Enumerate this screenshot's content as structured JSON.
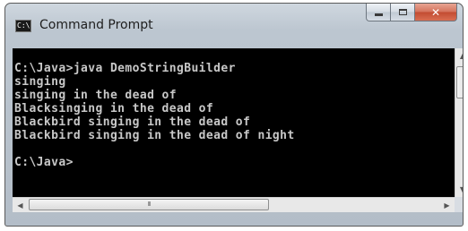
{
  "window": {
    "title": "Command Prompt",
    "icon": "cmd-icon",
    "icon_label": "C:\\",
    "close_glyph": "✕"
  },
  "console": {
    "lines": [
      "C:\\Java>java DemoStringBuilder",
      "singing",
      "singing in the dead of",
      "Blacksinging in the dead of",
      "Blackbird singing in the dead of",
      "Blackbird singing in the dead of night",
      "",
      "C:\\Java>"
    ]
  },
  "scrollbars": {
    "up_arrow": "▲",
    "down_arrow": "▼",
    "left_arrow": "◀",
    "right_arrow": "▶",
    "grip": "III"
  }
}
